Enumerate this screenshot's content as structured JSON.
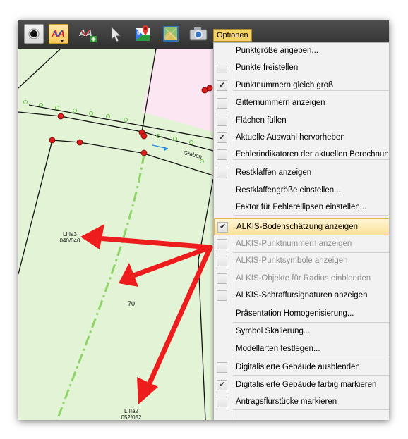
{
  "toolbar": {
    "tooltip": "Optionen",
    "icons": [
      "point-dot-icon",
      "alkis-letters-icon",
      "alkis-add-icon",
      "cursor-arrow-icon",
      "google-maps-icon",
      "orthophoto-icon",
      "camera-icon"
    ]
  },
  "map": {
    "labels": {
      "lllla3_top": "LIIIa3",
      "lllla3_bottom": "040/040",
      "number": "70",
      "lllla2_top": "LIIIa2",
      "lllla2_bottom": "052/052",
      "graben": "Graben"
    },
    "colors": {
      "field": "#e3f4d6",
      "parcel": "#fbe6f1",
      "arrow": "#ee1d1d",
      "point": "#e01b1b"
    }
  },
  "menu": {
    "items": [
      {
        "label": "Punktgröße angeben...",
        "checkbox": false
      },
      {
        "label": "Punkte freistellen",
        "checkbox": true,
        "checked": false
      },
      {
        "label": "Punktnummern gleich groß",
        "checkbox": true,
        "checked": true
      },
      {
        "label": "Gitternummern anzeigen",
        "checkbox": true,
        "checked": false
      },
      {
        "label": "Flächen füllen",
        "checkbox": true,
        "checked": false
      },
      {
        "label": "Aktuelle Auswahl hervorheben",
        "checkbox": true,
        "checked": true
      },
      {
        "label": "Fehlerindikatoren der aktuellen Berechnung",
        "checkbox": true,
        "checked": false
      },
      {
        "label": "Restklaffen anzeigen",
        "checkbox": true,
        "checked": false
      },
      {
        "label": "Restklaffengröße einstellen...",
        "checkbox": false
      },
      {
        "label": "Faktor für Fehlerellipsen einstellen...",
        "checkbox": false
      },
      {
        "label": "ALKIS-Bodenschätzung anzeigen",
        "checkbox": true,
        "checked": true,
        "highlighted": true
      },
      {
        "label": "ALKIS-Punktnummern anzeigen",
        "checkbox": true,
        "checked": false,
        "disabled": true
      },
      {
        "label": "ALKIS-Punktsymbole anzeigen",
        "checkbox": true,
        "checked": false,
        "disabled": true
      },
      {
        "label": "ALKIS-Objekte für Radius einblenden",
        "checkbox": true,
        "checked": false,
        "disabled": true
      },
      {
        "label": "ALKIS-Schraffursignaturen anzeigen",
        "checkbox": true,
        "checked": false
      },
      {
        "label": "Präsentation Homogenisierung...",
        "checkbox": false
      },
      {
        "label": "Symbol Skalierung...",
        "checkbox": false
      },
      {
        "label": "Modellarten festlegen...",
        "checkbox": false
      },
      {
        "label": "Digitalisierte Gebäude ausblenden",
        "checkbox": true,
        "checked": false
      },
      {
        "label": "Digitalisierte Gebäude farbig markieren",
        "checkbox": true,
        "checked": true
      },
      {
        "label": "Antragsflurstücke markieren",
        "checkbox": true,
        "checked": false
      }
    ]
  }
}
